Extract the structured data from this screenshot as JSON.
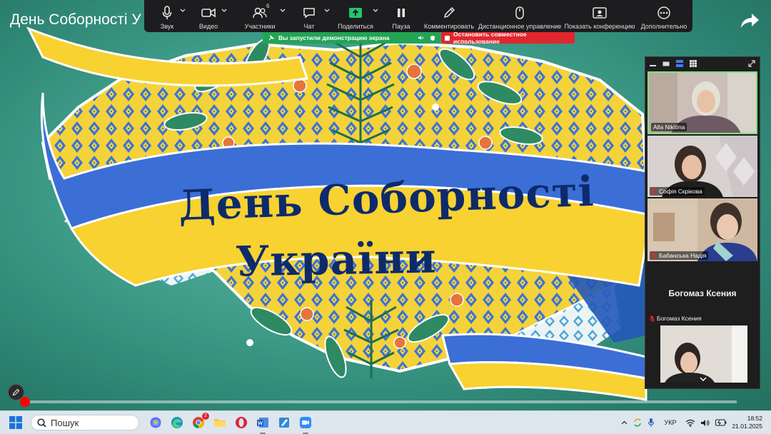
{
  "video": {
    "title": "День Соборності У",
    "banner_line1": "День Соборності",
    "banner_line2": "України",
    "progress": 0.003
  },
  "toolbar": {
    "items": [
      {
        "label": "Звук",
        "icon": "microphone-icon"
      },
      {
        "label": "Видео",
        "icon": "video-camera-icon"
      },
      {
        "label": "Участники",
        "icon": "participants-icon",
        "count": "6"
      },
      {
        "label": "Чат",
        "icon": "chat-icon"
      },
      {
        "label": "Поделиться",
        "icon": "share-screen-icon"
      },
      {
        "label": "Пауза",
        "icon": "pause-icon"
      },
      {
        "label": "Комментировать",
        "icon": "pencil-icon"
      },
      {
        "label": "Дистанционное управление",
        "icon": "mouse-icon"
      },
      {
        "label": "Показать конференцию",
        "icon": "show-meeting-icon"
      },
      {
        "label": "Дополнительно",
        "icon": "more-icon"
      }
    ]
  },
  "share": {
    "status": "Вы запустили демонстрацию экрана",
    "stop": "Остановить совместное использование"
  },
  "participants": [
    {
      "name": "Alla Nikitina",
      "muted": false,
      "active_speaker": true
    },
    {
      "name": "Софія Скрікова",
      "muted": true
    },
    {
      "name": "Бабанська Надія",
      "muted": true
    },
    {
      "name": "Богомаз Ксения",
      "display": "Богомаз Ксения",
      "muted": true
    }
  ],
  "taskbar": {
    "search_placeholder": "Пошук",
    "language": "УКР",
    "time": "18:52",
    "date": "21.01.2025",
    "chrome_badge": "2"
  },
  "colors": {
    "toolbar_bg": "#1d1d1f",
    "share_green": "#23a455",
    "stop_red": "#e2262d",
    "speaker_border": "#7ee07e",
    "flag_blue": "#3b6fd6",
    "flag_yellow": "#f7d231"
  }
}
